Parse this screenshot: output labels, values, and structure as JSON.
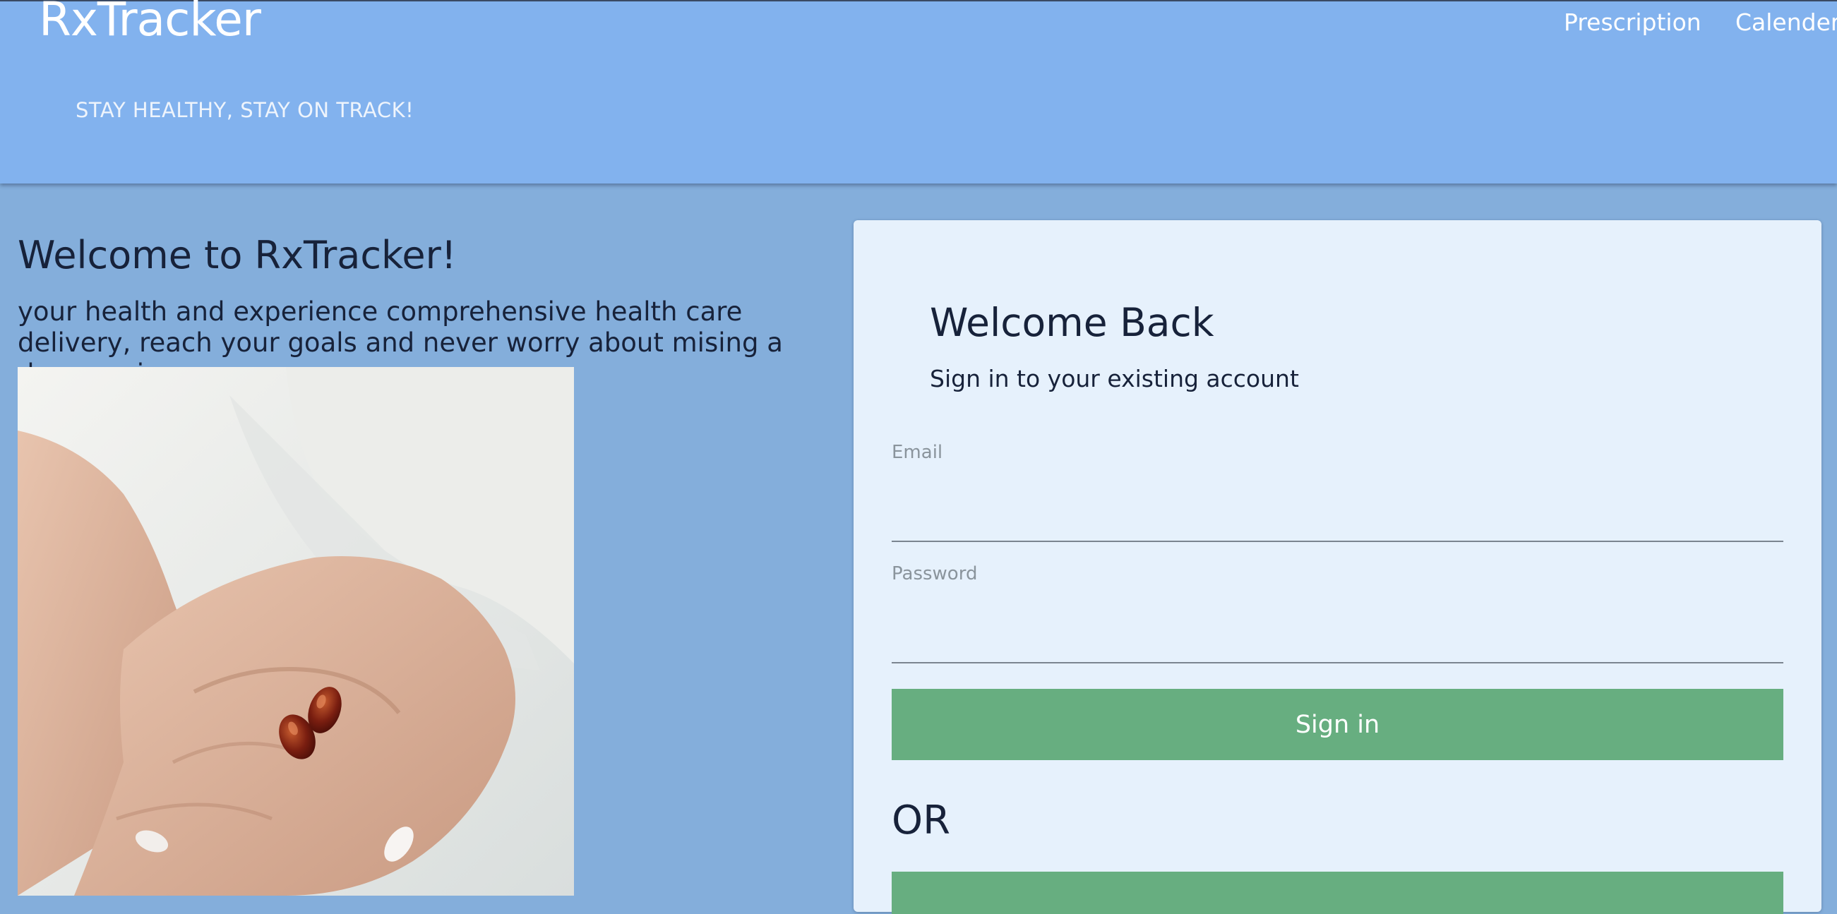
{
  "header": {
    "brand": "RxTracker",
    "tagline": "STAY HEALTHY, STAY ON TRACK!",
    "nav": {
      "prescription": "Prescription",
      "calender": "Calender"
    }
  },
  "hero": {
    "title": "Welcome to RxTracker!",
    "subtitle": "your health and experience comprehensive health care delivery, reach your goals and never worry about mising a dose again"
  },
  "login": {
    "title": "Welcome Back",
    "subtitle": "Sign in to your existing account",
    "email_label": "Email",
    "email_value": "",
    "password_label": "Password",
    "password_value": "",
    "sign_in_label": "Sign in",
    "or_text": "OR"
  },
  "colors": {
    "header_bg": "#82b2ee",
    "page_bg": "#84aedb",
    "card_bg": "#e6f1fc",
    "button_green": "#67ae80"
  },
  "icons": {
    "hero_image": "hands-holding-capsules-photo"
  }
}
